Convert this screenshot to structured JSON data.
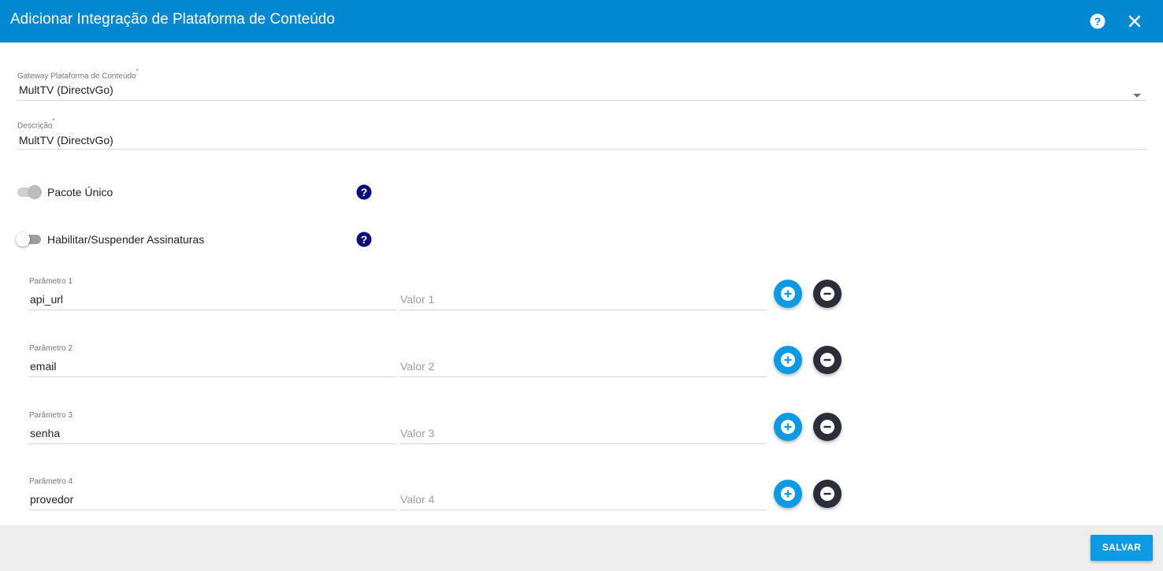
{
  "dialog": {
    "title": "Adicionar Integração de Plataforma de Conteúdo"
  },
  "form": {
    "gateway": {
      "label": "Gateway Plataforma de Conteúdo",
      "required": "*",
      "value": "MultTV (DirectvGo)"
    },
    "descricao": {
      "label": "Descrição",
      "required": "*",
      "value": "MultTV (DirectvGo)"
    },
    "toggles": [
      {
        "label": "Pacote Único",
        "state": "on-disabled"
      },
      {
        "label": "Habilitar/Suspender Assinaturas",
        "state": "off"
      }
    ],
    "params": [
      {
        "label": "Parâmetro 1",
        "value": "api_url",
        "valor_placeholder": "Valor 1"
      },
      {
        "label": "Parâmetro 2",
        "value": "email",
        "valor_placeholder": "Valor 2"
      },
      {
        "label": "Parâmetro 3",
        "value": "senha",
        "valor_placeholder": "Valor 3"
      },
      {
        "label": "Parâmetro 4",
        "value": "provedor",
        "valor_placeholder": "Valor 4"
      }
    ]
  },
  "footer": {
    "save_label": "SALVAR"
  },
  "colors": {
    "header": "#0288d1",
    "add_button": "#0b9be5",
    "remove_button": "#2b2d38",
    "help_icon": "#0d0d7a"
  },
  "icons": {
    "help": "help-circle-icon",
    "close": "close-icon",
    "add": "plus-circle-icon",
    "remove": "minus-circle-icon",
    "dropdown": "caret-down-icon"
  }
}
